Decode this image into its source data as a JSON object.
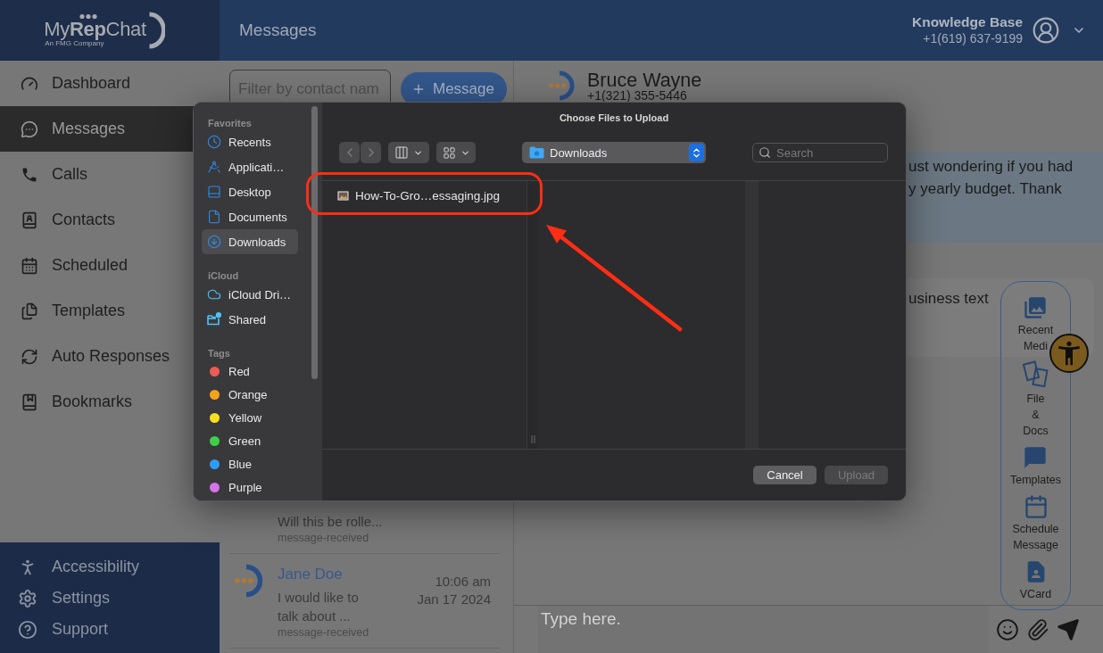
{
  "app_sidebar": {
    "logo": {
      "wordmark": "My**Rep**Chat",
      "tagline": "An FMG Company"
    },
    "nav_items": [
      {
        "label": "Dashboard",
        "selected": false
      },
      {
        "label": "Messages",
        "selected": true
      },
      {
        "label": "Calls",
        "selected": false
      },
      {
        "label": "Contacts",
        "selected": false
      },
      {
        "label": "Scheduled",
        "selected": false
      },
      {
        "label": "Templates",
        "selected": false
      },
      {
        "label": "Auto Responses",
        "selected": false
      },
      {
        "label": "Bookmarks",
        "selected": false
      }
    ],
    "footer_items": [
      {
        "label": "Accessibility"
      },
      {
        "label": "Settings"
      },
      {
        "label": "Support"
      }
    ]
  },
  "header": {
    "title": "Messages",
    "account": {
      "name": "Knowledge Base",
      "phone": "+1(619) 637-9199"
    }
  },
  "conversation_list": {
    "filter": {
      "placeholder": "Filter by contact nam"
    },
    "new_message_button": "Message",
    "conversations": [
      {
        "preview": "Will this be rolle...",
        "status": "message-received"
      },
      {
        "avatar": true,
        "name": "Jane Doe",
        "time": "10:06 am",
        "date": "Jan 17 2024",
        "preview": "I would like to\ntalk about ...",
        "status": "message-received"
      }
    ]
  },
  "chat": {
    "contact": {
      "name": "Bruce Wayne",
      "phone": "+1(321) 355-5446"
    },
    "messages": [
      {
        "kind": "sent",
        "lines": [
          "ust wondering if you had",
          "y yearly budget. Thank"
        ]
      },
      {
        "kind": "received",
        "lines": [
          "usiness text"
        ]
      }
    ],
    "attachment_menu": [
      {
        "label": "Recent Medi"
      },
      {
        "label": "File & Docs"
      },
      {
        "label": "Templates"
      },
      {
        "label": "Schedule Message"
      },
      {
        "label": "VCard"
      }
    ],
    "composer": {
      "placeholder": "Type here."
    }
  },
  "file_dialog": {
    "title": "Choose Files to Upload",
    "sidebar": [
      {
        "kind": "places",
        "heading": "Favorites",
        "items": [
          {
            "label": "Recents",
            "selected": false
          },
          {
            "label": "Applicati…",
            "selected": false
          },
          {
            "label": "Desktop",
            "selected": false
          },
          {
            "label": "Documents",
            "selected": false
          },
          {
            "label": "Downloads",
            "selected": true
          }
        ]
      },
      {
        "kind": "places",
        "heading": "iCloud",
        "items": [
          {
            "label": "iCloud Dri…",
            "selected": false
          },
          {
            "label": "Shared",
            "selected": false
          }
        ]
      },
      {
        "kind": "tags",
        "heading": "Tags",
        "items": [
          {
            "label": "Red",
            "color": "#ef5b52",
            "selected": false
          },
          {
            "label": "Orange",
            "color": "#f6a31c",
            "selected": false
          },
          {
            "label": "Yellow",
            "color": "#f6df1f",
            "selected": false
          },
          {
            "label": "Green",
            "color": "#3ed04a",
            "selected": false
          },
          {
            "label": "Blue",
            "color": "#2d9cf4",
            "selected": false
          },
          {
            "label": "Purple",
            "color": "#d473ea",
            "selected": false
          }
        ]
      }
    ],
    "location": "Downloads",
    "search": {
      "placeholder": "Search"
    },
    "files": [
      {
        "name": "How-To-Gro…essaging.jpg",
        "selected": false
      }
    ],
    "buttons": [
      {
        "label": "Cancel",
        "disabled": false
      },
      {
        "label": "Upload",
        "disabled": true
      }
    ]
  }
}
